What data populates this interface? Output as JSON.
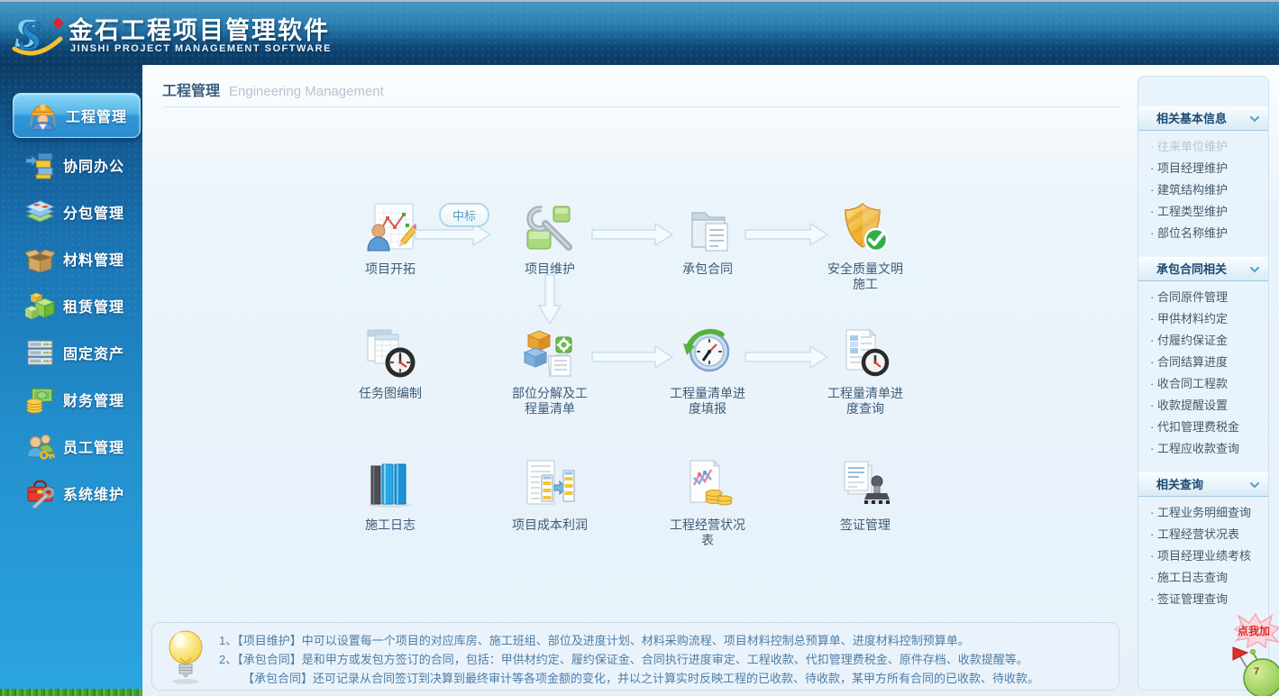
{
  "header": {
    "title": "金石工程项目管理软件",
    "subtitle": "JINSHI PROJECT MANAGEMENT SOFTWARE",
    "logo_icon": "jinshi-s-logo",
    "colors": {
      "header_top": "#4496c4",
      "header_bottom": "#0b3a61"
    }
  },
  "sidebar": {
    "items": [
      {
        "label": "工程管理",
        "icon": "construction-worker-icon",
        "active": true
      },
      {
        "label": "协同办公",
        "icon": "office-blocks-icon",
        "active": false
      },
      {
        "label": "分包管理",
        "icon": "layers-icon",
        "active": false
      },
      {
        "label": "材料管理",
        "icon": "open-box-icon",
        "active": false
      },
      {
        "label": "租赁管理",
        "icon": "green-cubes-icon",
        "active": false
      },
      {
        "label": "固定资产",
        "icon": "server-rack-icon",
        "active": false
      },
      {
        "label": "财务管理",
        "icon": "money-icon",
        "active": false
      },
      {
        "label": "员工管理",
        "icon": "people-key-icon",
        "active": false
      },
      {
        "label": "系统维护",
        "icon": "toolbox-wrench-icon",
        "active": false
      }
    ]
  },
  "main": {
    "title_zh": "工程管理",
    "title_en": "Engineering Management",
    "flow": {
      "bid_badge": "中标",
      "rows": [
        {
          "items": [
            {
              "label": "项目开拓",
              "icon": "project-development-icon"
            },
            {
              "label": "项目维护",
              "icon": "project-maintenance-icon"
            },
            {
              "label": "承包合同",
              "icon": "contract-folder-icon"
            },
            {
              "label": "安全质量文明施工",
              "icon": "safety-shield-icon"
            }
          ]
        },
        {
          "items": [
            {
              "label": "任务图编制",
              "icon": "task-chart-clock-icon"
            },
            {
              "label": "部位分解及工程量清单",
              "icon": "parts-bom-icon"
            },
            {
              "label": "工程量清单进度填报",
              "icon": "progress-fill-clock-icon"
            },
            {
              "label": "工程量清单进度查询",
              "icon": "progress-query-doc-icon"
            }
          ]
        },
        {
          "items": [
            {
              "label": "施工日志",
              "icon": "log-books-icon"
            },
            {
              "label": "项目成本利润",
              "icon": "cost-profit-doc-icon"
            },
            {
              "label": "工程经营状况表",
              "icon": "operation-chart-coins-icon"
            },
            {
              "label": "签证管理",
              "icon": "visa-stamp-icon"
            }
          ]
        }
      ]
    },
    "tips": {
      "icon": "light-bulb-icon",
      "lines": [
        "1、【项目维护】中可以设置每一个项目的对应库房、施工班组、部位及进度计划、材料采购流程、项目材料控制总预算单、进度材料控制预算单。",
        "2、【承包合同】是和甲方或发包方签订的合同，包括：甲供材约定、履约保证金、合同执行进度审定、工程收款、代扣管理费税金、原件存档、收款提醒等。",
        "【承包合同】还可记录从合同签订到决算到最终审计等各项金额的变化，并以之计算实时反映工程的已收款、待收款，某甲方所有合同的已收款、待收款。"
      ]
    }
  },
  "right_panel": {
    "sections": [
      {
        "title": "相关基本信息",
        "items": [
          "往来单位维护",
          "项目经理维护",
          "建筑结构维护",
          "工程类型维护",
          "部位名称维护"
        ]
      },
      {
        "title": "承包合同相关",
        "items": [
          "合同原件管理",
          "甲供材料约定",
          "付履约保证金",
          "合同结算进度",
          "收合同工程款",
          "收款提醒设置",
          "代扣管理费税金",
          "工程应收款查询"
        ]
      },
      {
        "title": "相关查询",
        "items": [
          "工程业务明细查询",
          "工程经营状况表",
          "项目经理业绩考核",
          "施工日志查询",
          "签证管理查询"
        ]
      }
    ]
  },
  "mascot": {
    "bubble_text": "点我加",
    "body_text": "7"
  }
}
